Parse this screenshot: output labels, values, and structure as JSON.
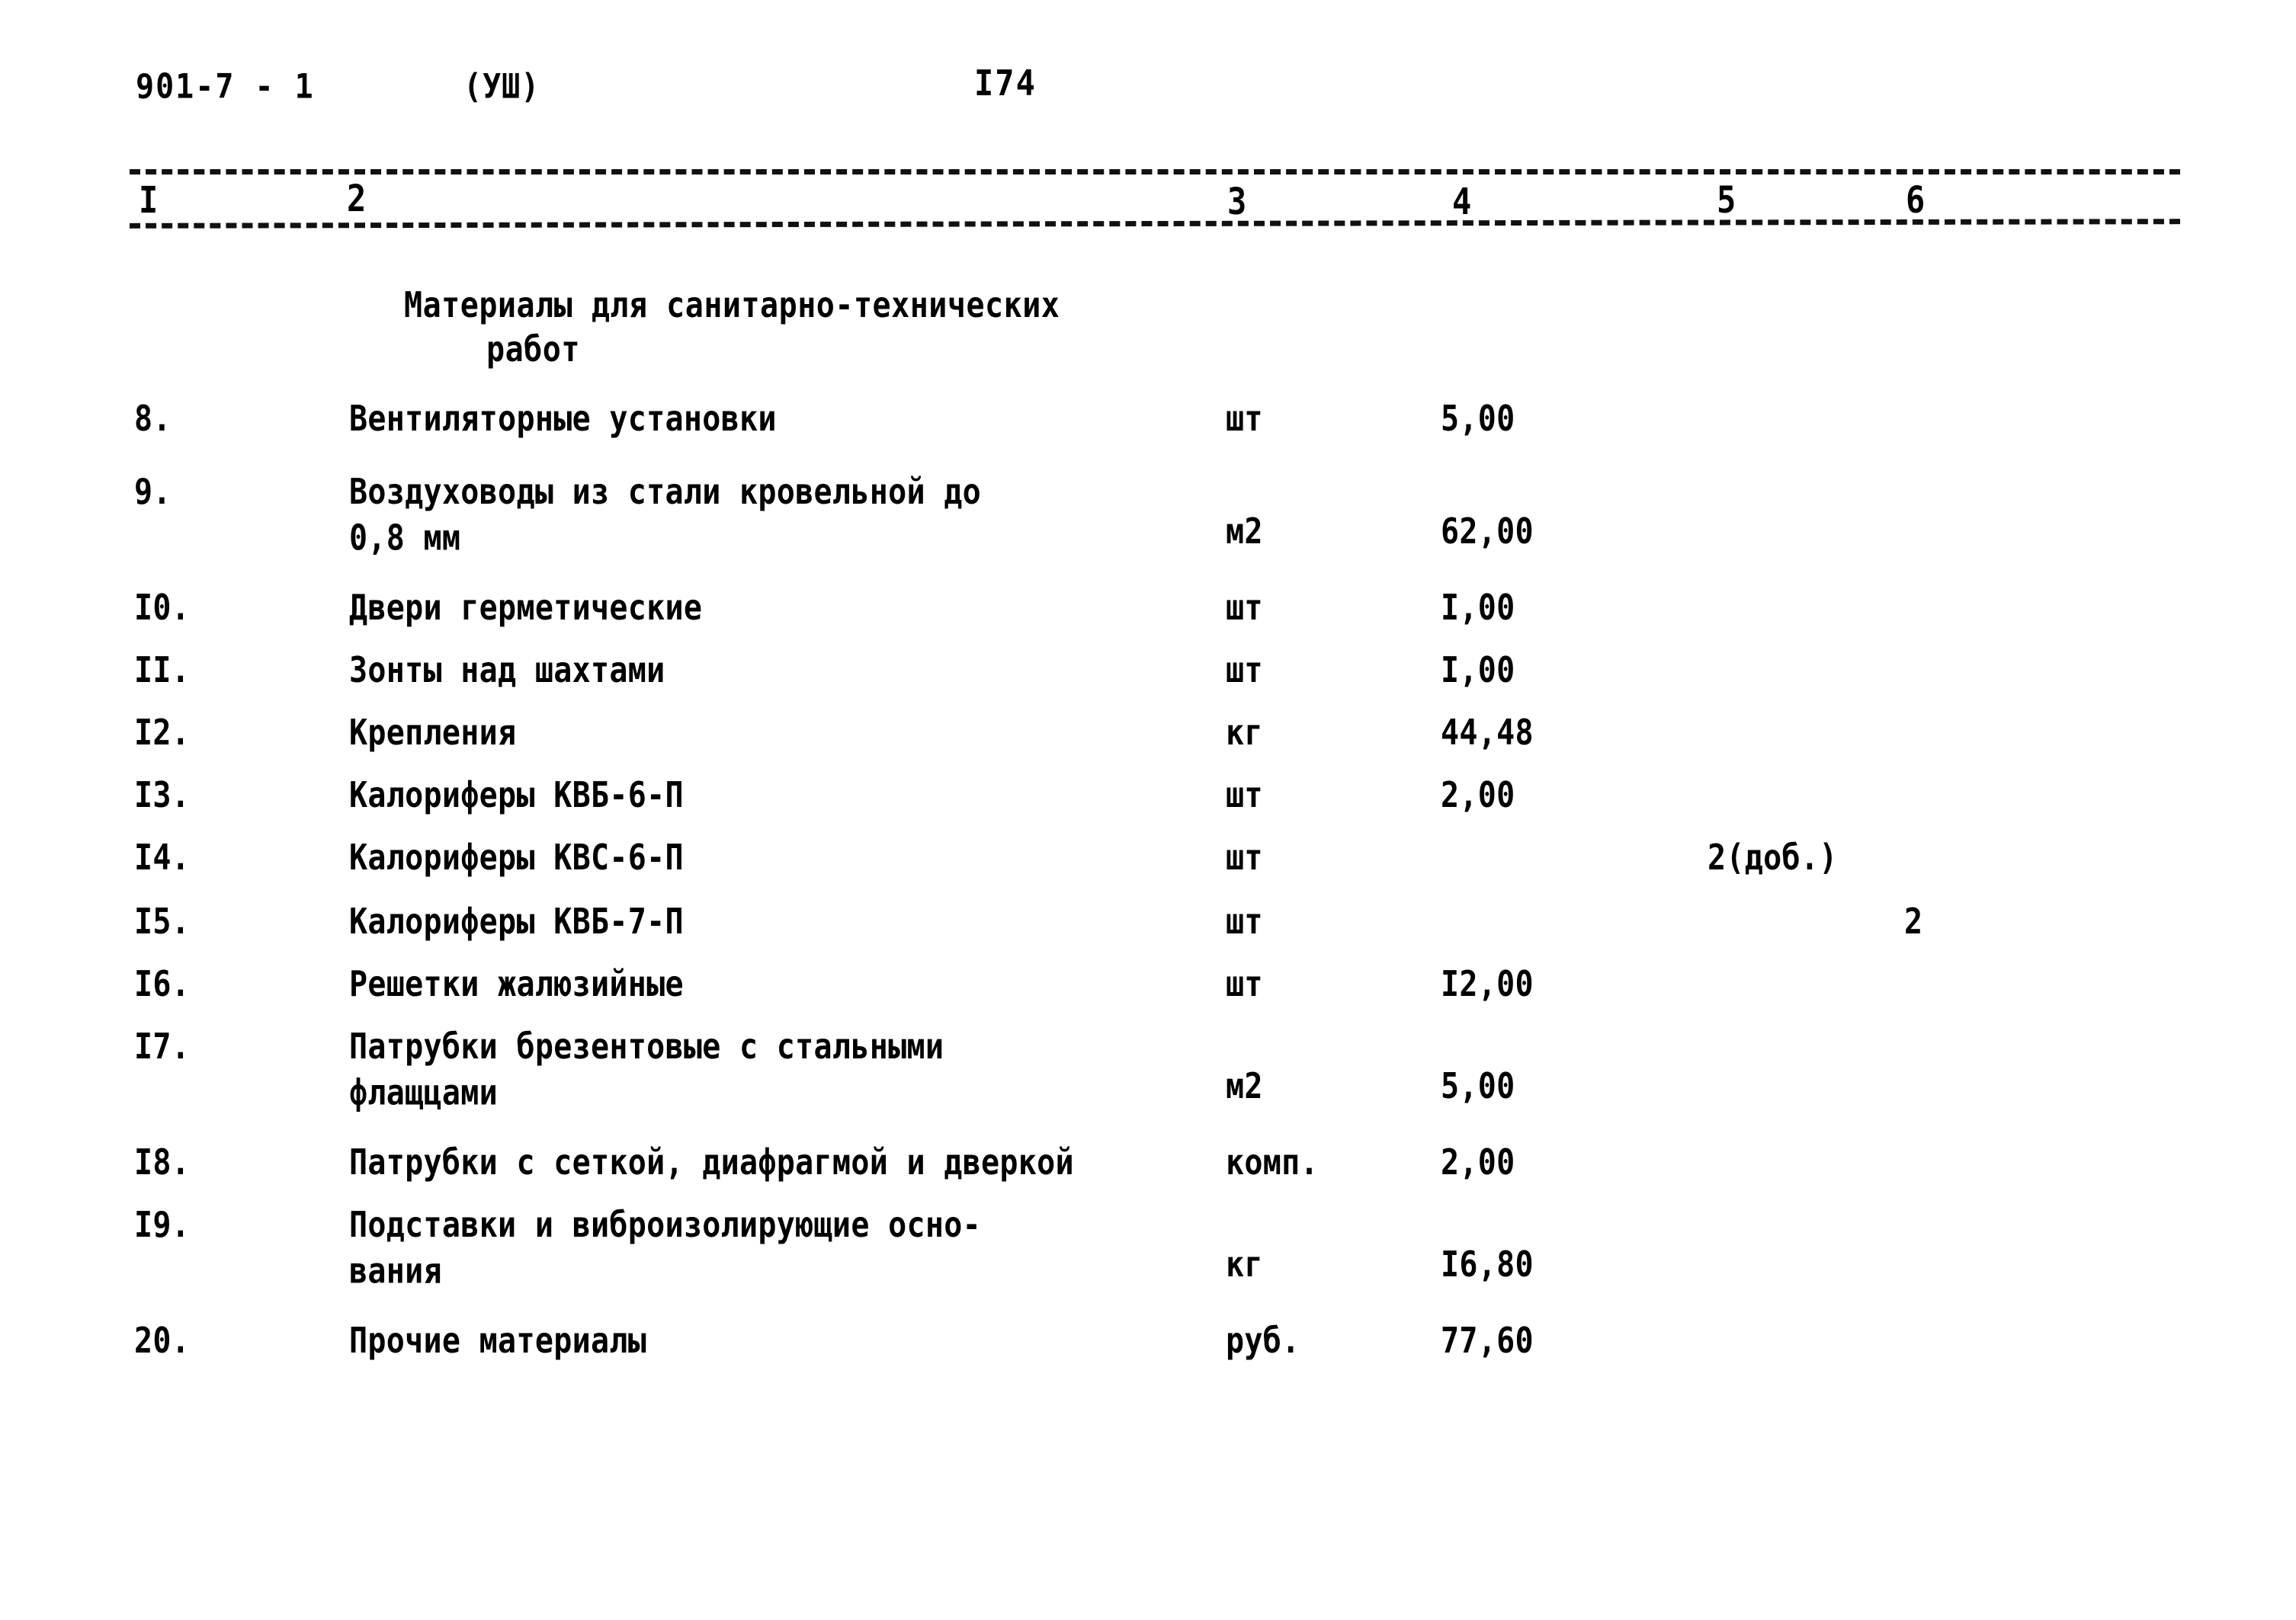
{
  "document": {
    "code": "901-7 - 1",
    "series": "(УШ)",
    "page_number": "І74"
  },
  "column_headers": {
    "c1": "І",
    "c2": "2",
    "c3": "3",
    "c4": "4",
    "c5": "5",
    "c6": "6"
  },
  "section": {
    "title_line1": "Материалы для санитарно-технических",
    "title_line2": "работ"
  },
  "rows": [
    {
      "no": "8.",
      "name": "Вентиляторные установки",
      "unit": "шт",
      "qty": "5,00",
      "add": "",
      "alt": ""
    },
    {
      "no": "9.",
      "name": "Воздуховоды из стали кровельной до\n0,8 мм",
      "unit": "м2",
      "qty": "62,00",
      "add": "",
      "alt": ""
    },
    {
      "no": "І0.",
      "name": "Двери герметические",
      "unit": "шт",
      "qty": "І,00",
      "add": "",
      "alt": ""
    },
    {
      "no": "ІІ.",
      "name": "Зонты над шахтами",
      "unit": "шт",
      "qty": "І,00",
      "add": "",
      "alt": ""
    },
    {
      "no": "І2.",
      "name": "Крепления",
      "unit": "кг",
      "qty": "44,48",
      "add": "",
      "alt": ""
    },
    {
      "no": "І3.",
      "name": "Калориферы КВБ-6-П",
      "unit": "шт",
      "qty": "2,00",
      "add": "",
      "alt": ""
    },
    {
      "no": "І4.",
      "name": "Калориферы КВС-6-П",
      "unit": "шт",
      "qty": "",
      "add": "2(доб.)",
      "alt": ""
    },
    {
      "no": "І5.",
      "name": "Калориферы КВБ-7-П",
      "unit": "шт",
      "qty": "",
      "add": "",
      "alt": "2"
    },
    {
      "no": "І6.",
      "name": "Решетки жалюзийные",
      "unit": "шт",
      "qty": "І2,00",
      "add": "",
      "alt": ""
    },
    {
      "no": "І7.",
      "name": "Патрубки брезентовые с стальными\nфлащцами",
      "unit": "м2",
      "qty": "5,00",
      "add": "",
      "alt": ""
    },
    {
      "no": "І8.",
      "name": "Патрубки с сеткой, диафрагмой и дверкой",
      "unit": "комп.",
      "qty": "2,00",
      "add": "",
      "alt": ""
    },
    {
      "no": "І9.",
      "name": "Подставки и виброизолирующие осно-\nвания",
      "unit": "кг",
      "qty": "І6,80",
      "add": "",
      "alt": ""
    },
    {
      "no": "20.",
      "name": "Прочие материалы",
      "unit": "руб.",
      "qty": "77,60",
      "add": "",
      "alt": ""
    }
  ],
  "row_layout": [
    {
      "top": 0,
      "name_lines": 1,
      "unit_offset": 0,
      "qty_offset": 0
    },
    {
      "top": 96,
      "name_lines": 2,
      "unit_offset": 52,
      "qty_offset": 52
    },
    {
      "top": 248,
      "name_lines": 1,
      "unit_offset": 0,
      "qty_offset": 0
    },
    {
      "top": 330,
      "name_lines": 1,
      "unit_offset": 0,
      "qty_offset": 0
    },
    {
      "top": 412,
      "name_lines": 1,
      "unit_offset": 0,
      "qty_offset": 0
    },
    {
      "top": 494,
      "name_lines": 1,
      "unit_offset": 0,
      "qty_offset": 0
    },
    {
      "top": 576,
      "name_lines": 1,
      "unit_offset": 0,
      "qty_offset": 0
    },
    {
      "top": 660,
      "name_lines": 1,
      "unit_offset": 0,
      "qty_offset": 0
    },
    {
      "top": 742,
      "name_lines": 1,
      "unit_offset": 0,
      "qty_offset": 0
    },
    {
      "top": 824,
      "name_lines": 2,
      "unit_offset": 52,
      "qty_offset": 52
    },
    {
      "top": 976,
      "name_lines": 1,
      "unit_offset": 0,
      "qty_offset": 0
    },
    {
      "top": 1058,
      "name_lines": 2,
      "unit_offset": 52,
      "qty_offset": 52
    },
    {
      "top": 1210,
      "name_lines": 1,
      "unit_offset": 0,
      "qty_offset": 0
    }
  ]
}
